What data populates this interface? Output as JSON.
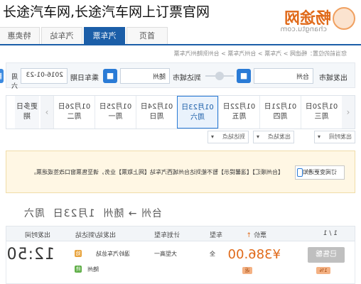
{
  "overlay_title": "长途汽车网,长途汽车网上订票官网",
  "logo": {
    "name": "畅途网",
    "domain": "changtu.com"
  },
  "nav": {
    "tabs": [
      "首页",
      "汽车票",
      "汽车站",
      "特卖惠"
    ],
    "active_index": 1
  },
  "breadcrumb": "您当前的位置：畅途网 > 汽车票 > 台州汽车票 > 台州到随州汽车票",
  "search": {
    "from_label": "出发城市",
    "from_value": "台州",
    "to_label": "到达城市",
    "to_value": "随州",
    "date_label": "乘车日期",
    "date_value": "2016-01-23",
    "weekday": "周六"
  },
  "dates": [
    {
      "date": "01月20日",
      "week": "周三"
    },
    {
      "date": "01月21日",
      "week": "周四"
    },
    {
      "date": "01月22日",
      "week": "周五"
    },
    {
      "date": "01月23日",
      "week": "周六"
    },
    {
      "date": "01月24日",
      "week": "周日"
    },
    {
      "date": "01月25日",
      "week": "周一"
    },
    {
      "date": "01月26日",
      "week": "周二"
    }
  ],
  "active_date_index": 3,
  "more_dates": "更多日期",
  "filters": {
    "time": "出发时间",
    "from_station": "出发站点",
    "to_station": "到达站点"
  },
  "notice": {
    "text": "【台州顺汇】【温馨提示】暂不能到达台州城西汽车站【网上取票】业务，请至售票窗口改签或退票。",
    "button": "订阅变更通知"
  },
  "route": {
    "from": "台州",
    "arrow": "→",
    "to": "随州",
    "date": "1月23日",
    "week": "周六"
  },
  "table": {
    "headers": {
      "time": "出发时间",
      "station": "出发站/到达站",
      "model": "计划车型",
      "type": "车型",
      "price": "票价",
      "sort": "↑",
      "page": "1 / 1"
    },
    "rows": [
      {
        "time": "12:50",
        "from_tag": "始",
        "from_station": "温岭汽车总站",
        "to_tag": "终",
        "to_station": "随州",
        "model": "大型高一",
        "type": "全",
        "price": "¥386.00",
        "extra_tag": "返",
        "buy": "已售罄",
        "badge": "1%"
      }
    ]
  }
}
